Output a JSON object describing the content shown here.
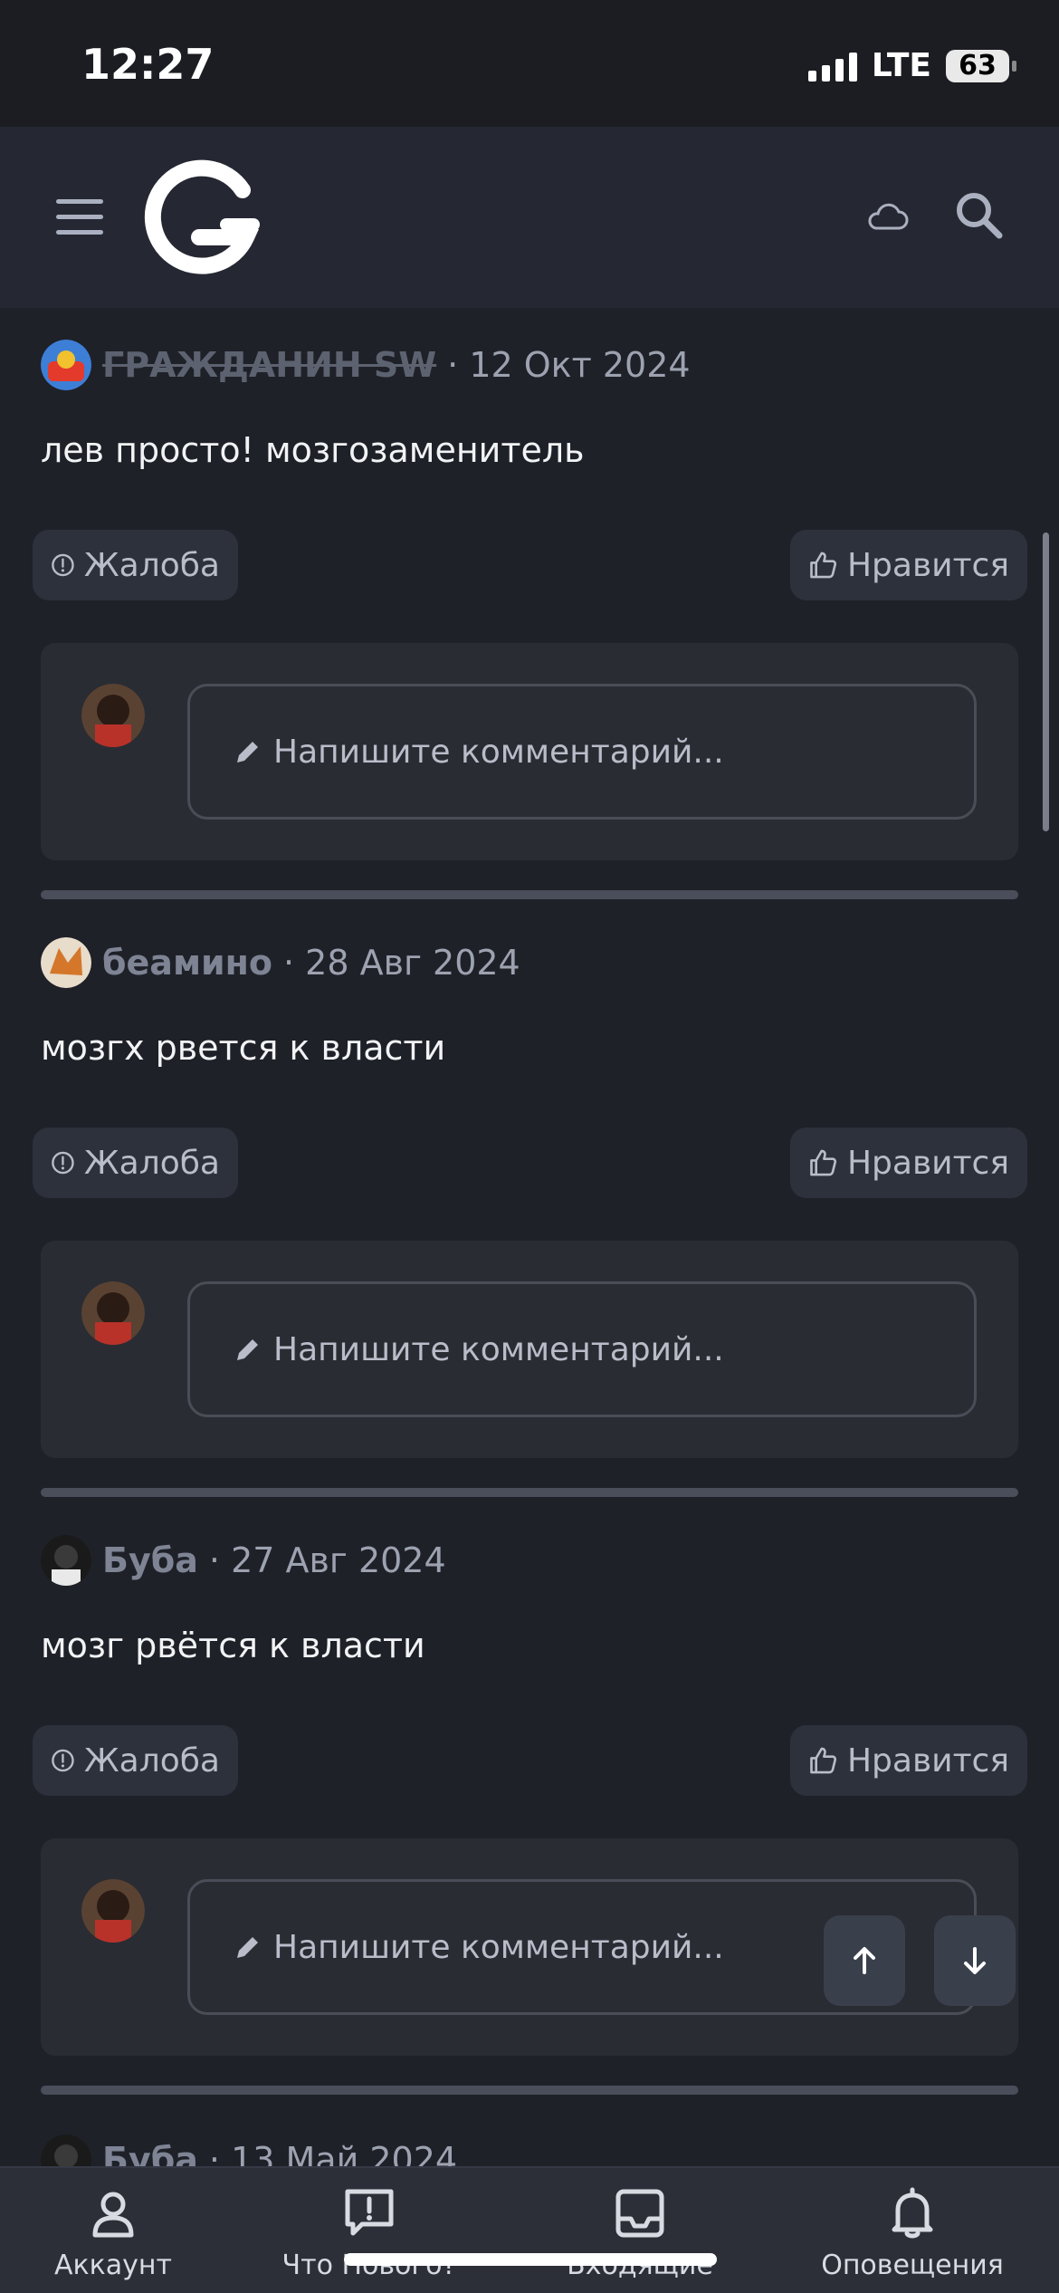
{
  "status_bar": {
    "time": "12:27",
    "network": "LTE",
    "battery": "63"
  },
  "header": {
    "menu_icon": "menu-icon",
    "logo_icon": "site-logo",
    "cloud_icon": "cloud-icon",
    "search_icon": "search-icon"
  },
  "posts": [
    {
      "author": "ГРАЖДАНИН SW",
      "author_struck": true,
      "date": "· 12 Окт 2024",
      "text": "лев просто! мозгозаменитель",
      "report_label": "Жалоба",
      "like_label": "Нравится",
      "comment_placeholder": "Напишите комментарий..."
    },
    {
      "author": "беамино",
      "author_struck": false,
      "date": "· 28 Авг 2024",
      "text": "мозгх рвется к власти",
      "report_label": "Жалоба",
      "like_label": "Нравится",
      "comment_placeholder": "Напишите комментарий..."
    },
    {
      "author": "Буба",
      "author_struck": false,
      "date": "· 27 Авг 2024",
      "text": "мозг рвётся к власти",
      "report_label": "Жалоба",
      "like_label": "Нравится",
      "comment_placeholder": "Напишите комментарий..."
    },
    {
      "author": "Буба",
      "author_struck": false,
      "date": "· 13 Май 2024"
    }
  ],
  "tabbar": {
    "items": [
      {
        "label": "Аккаунт",
        "icon": "user-icon"
      },
      {
        "label": "Что Нового?",
        "icon": "alert-message-icon"
      },
      {
        "label": "Входящие",
        "icon": "inbox-icon"
      },
      {
        "label": "Оповещения",
        "icon": "bell-icon"
      }
    ]
  },
  "colors": {
    "background": "#1f2129",
    "header": "#252833",
    "button": "#2d313c",
    "comment_box": "#2a2c33"
  }
}
